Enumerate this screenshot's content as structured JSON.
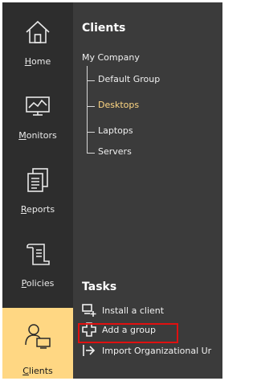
{
  "nav": {
    "items": [
      {
        "label": "Home",
        "icon": "home-icon"
      },
      {
        "label": "Monitors",
        "icon": "monitor-icon"
      },
      {
        "label": "Reports",
        "icon": "reports-icon"
      },
      {
        "label": "Policies",
        "icon": "policies-icon"
      },
      {
        "label": "Clients",
        "icon": "clients-icon"
      }
    ],
    "active": "Clients"
  },
  "clients": {
    "heading": "Clients",
    "company": "My Company",
    "groups": [
      {
        "label": "Default Group"
      },
      {
        "label": "Desktops"
      },
      {
        "label": "Laptops"
      },
      {
        "label": "Servers"
      }
    ],
    "selected_group": "Desktops"
  },
  "tasks": {
    "heading": "Tasks",
    "items": [
      {
        "label": "Install a client",
        "icon": "install-client-icon"
      },
      {
        "label": "Add a group",
        "icon": "add-group-icon"
      },
      {
        "label": "Import Organizational Ur",
        "icon": "import-icon"
      }
    ]
  },
  "colors": {
    "nav_bg": "#2d2d2d",
    "panel_bg": "#3b3b3b",
    "active_bg": "#ffd783",
    "selected_text": "#ffd783",
    "highlight_border": "#e01010"
  }
}
